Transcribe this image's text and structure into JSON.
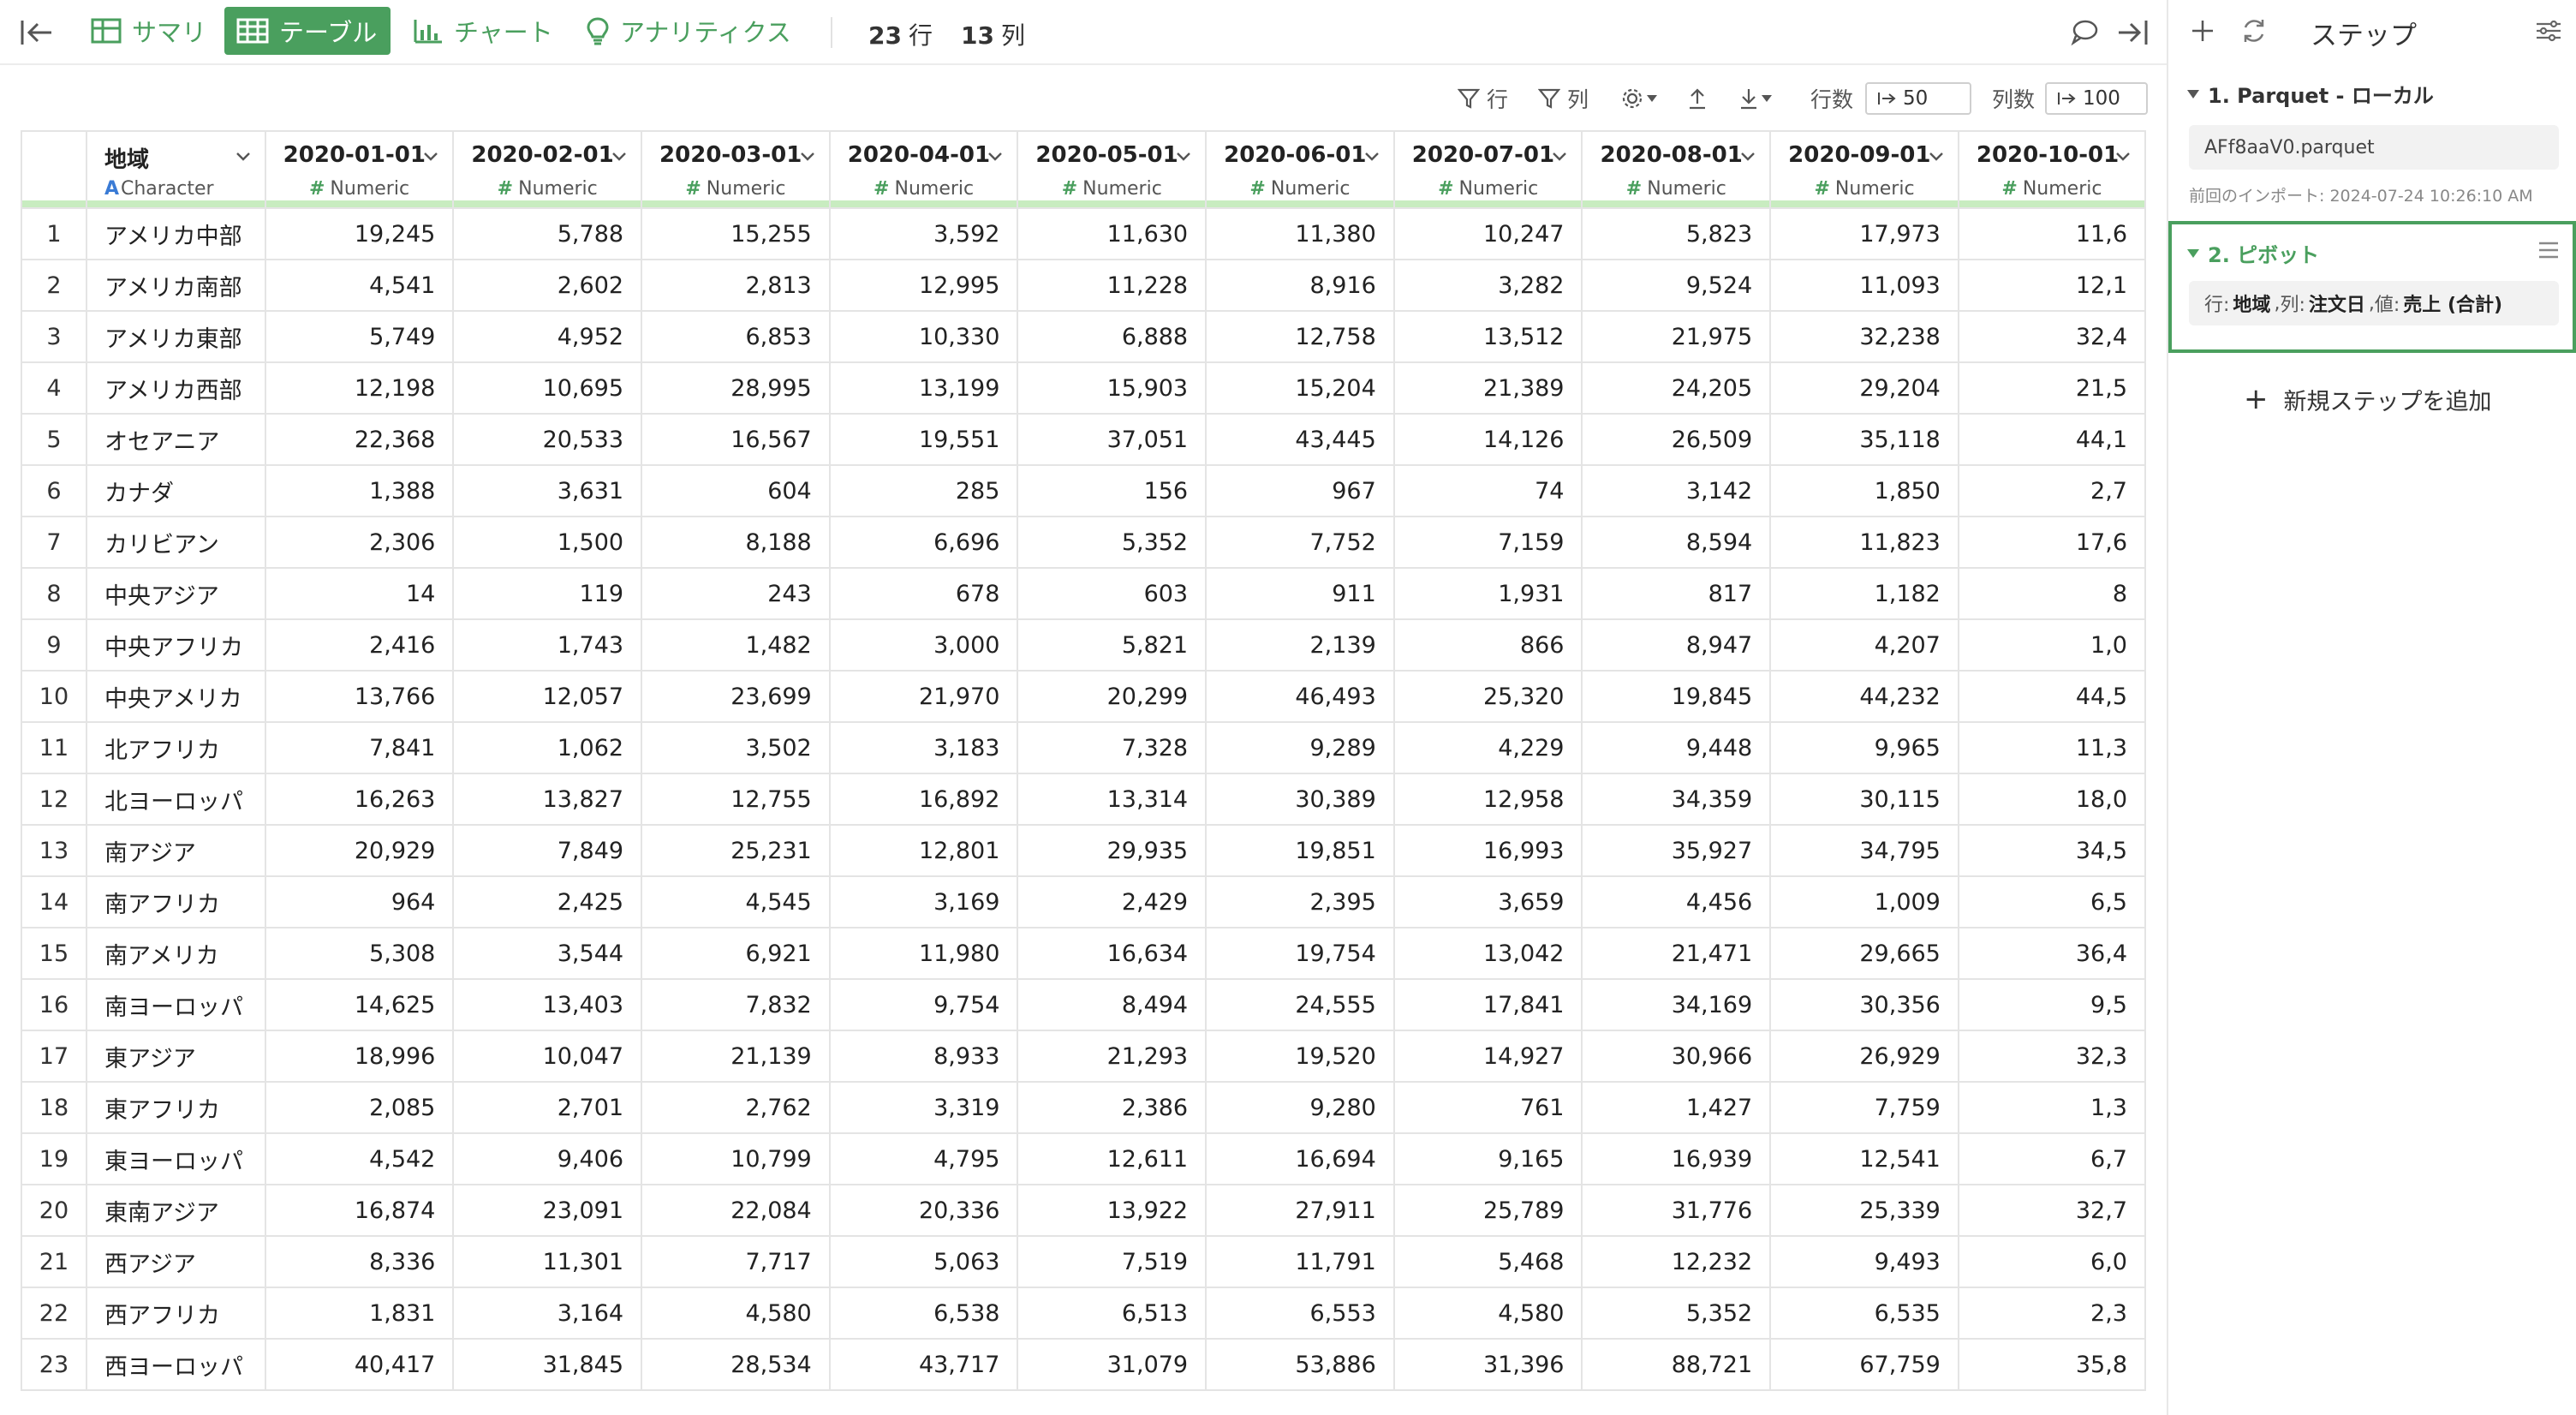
{
  "toolbar": {
    "tabs": [
      {
        "label": "サマリ",
        "active": false,
        "icon": "summary-grid-icon"
      },
      {
        "label": "テーブル",
        "active": true,
        "icon": "table-icon"
      },
      {
        "label": "チャート",
        "active": false,
        "icon": "chart-icon"
      },
      {
        "label": "アナリティクス",
        "active": false,
        "icon": "lightbulb-icon"
      }
    ],
    "row_count": "23",
    "row_count_unit": "行",
    "col_count": "13",
    "col_count_unit": "列"
  },
  "toolbar2": {
    "row_filter_label": "行",
    "col_filter_label": "列",
    "rows_label": "行数",
    "rows_value": "50",
    "cols_label": "列数",
    "cols_value": "100"
  },
  "table": {
    "columns": [
      {
        "name": "地域",
        "type": "Character"
      },
      {
        "name": "2020-01-01",
        "type": "Numeric"
      },
      {
        "name": "2020-02-01",
        "type": "Numeric"
      },
      {
        "name": "2020-03-01",
        "type": "Numeric"
      },
      {
        "name": "2020-04-01",
        "type": "Numeric"
      },
      {
        "name": "2020-05-01",
        "type": "Numeric"
      },
      {
        "name": "2020-06-01",
        "type": "Numeric"
      },
      {
        "name": "2020-07-01",
        "type": "Numeric"
      },
      {
        "name": "2020-08-01",
        "type": "Numeric"
      },
      {
        "name": "2020-09-01",
        "type": "Numeric"
      },
      {
        "name": "2020-10-01",
        "type": "Numeric"
      }
    ],
    "rows": [
      [
        "アメリカ中部",
        "19,245",
        "5,788",
        "15,255",
        "3,592",
        "11,630",
        "11,380",
        "10,247",
        "5,823",
        "17,973",
        "11,6"
      ],
      [
        "アメリカ南部",
        "4,541",
        "2,602",
        "2,813",
        "12,995",
        "11,228",
        "8,916",
        "3,282",
        "9,524",
        "11,093",
        "12,1"
      ],
      [
        "アメリカ東部",
        "5,749",
        "4,952",
        "6,853",
        "10,330",
        "6,888",
        "12,758",
        "13,512",
        "21,975",
        "32,238",
        "32,4"
      ],
      [
        "アメリカ西部",
        "12,198",
        "10,695",
        "28,995",
        "13,199",
        "15,903",
        "15,204",
        "21,389",
        "24,205",
        "29,204",
        "21,5"
      ],
      [
        "オセアニア",
        "22,368",
        "20,533",
        "16,567",
        "19,551",
        "37,051",
        "43,445",
        "14,126",
        "26,509",
        "35,118",
        "44,1"
      ],
      [
        "カナダ",
        "1,388",
        "3,631",
        "604",
        "285",
        "156",
        "967",
        "74",
        "3,142",
        "1,850",
        "2,7"
      ],
      [
        "カリビアン",
        "2,306",
        "1,500",
        "8,188",
        "6,696",
        "5,352",
        "7,752",
        "7,159",
        "8,594",
        "11,823",
        "17,6"
      ],
      [
        "中央アジア",
        "14",
        "119",
        "243",
        "678",
        "603",
        "911",
        "1,931",
        "817",
        "1,182",
        "8"
      ],
      [
        "中央アフリカ",
        "2,416",
        "1,743",
        "1,482",
        "3,000",
        "5,821",
        "2,139",
        "866",
        "8,947",
        "4,207",
        "1,0"
      ],
      [
        "中央アメリカ",
        "13,766",
        "12,057",
        "23,699",
        "21,970",
        "20,299",
        "46,493",
        "25,320",
        "19,845",
        "44,232",
        "44,5"
      ],
      [
        "北アフリカ",
        "7,841",
        "1,062",
        "3,502",
        "3,183",
        "7,328",
        "9,289",
        "4,229",
        "9,448",
        "9,965",
        "11,3"
      ],
      [
        "北ヨーロッパ",
        "16,263",
        "13,827",
        "12,755",
        "16,892",
        "13,314",
        "30,389",
        "12,958",
        "34,359",
        "30,115",
        "18,0"
      ],
      [
        "南アジア",
        "20,929",
        "7,849",
        "25,231",
        "12,801",
        "29,935",
        "19,851",
        "16,993",
        "35,927",
        "34,795",
        "34,5"
      ],
      [
        "南アフリカ",
        "964",
        "2,425",
        "4,545",
        "3,169",
        "2,429",
        "2,395",
        "3,659",
        "4,456",
        "1,009",
        "6,5"
      ],
      [
        "南アメリカ",
        "5,308",
        "3,544",
        "6,921",
        "11,980",
        "16,634",
        "19,754",
        "13,042",
        "21,471",
        "29,665",
        "36,4"
      ],
      [
        "南ヨーロッパ",
        "14,625",
        "13,403",
        "7,832",
        "9,754",
        "8,494",
        "24,555",
        "17,841",
        "34,169",
        "30,356",
        "9,5"
      ],
      [
        "東アジア",
        "18,996",
        "10,047",
        "21,139",
        "8,933",
        "21,293",
        "19,520",
        "14,927",
        "30,966",
        "26,929",
        "32,3"
      ],
      [
        "東アフリカ",
        "2,085",
        "2,701",
        "2,762",
        "3,319",
        "2,386",
        "9,280",
        "761",
        "1,427",
        "7,759",
        "1,3"
      ],
      [
        "東ヨーロッパ",
        "4,542",
        "9,406",
        "10,799",
        "4,795",
        "12,611",
        "16,694",
        "9,165",
        "16,939",
        "12,541",
        "6,7"
      ],
      [
        "東南アジア",
        "16,874",
        "23,091",
        "22,084",
        "20,336",
        "13,922",
        "27,911",
        "25,789",
        "31,776",
        "25,339",
        "32,7"
      ],
      [
        "西アジア",
        "8,336",
        "11,301",
        "7,717",
        "5,063",
        "7,519",
        "11,791",
        "5,468",
        "12,232",
        "9,493",
        "6,0"
      ],
      [
        "西アフリカ",
        "1,831",
        "3,164",
        "4,580",
        "6,538",
        "6,513",
        "6,553",
        "4,580",
        "5,352",
        "6,535",
        "2,3"
      ],
      [
        "西ヨーロッパ",
        "40,417",
        "31,845",
        "28,534",
        "43,717",
        "31,079",
        "53,886",
        "31,396",
        "88,721",
        "67,759",
        "35,8"
      ]
    ]
  },
  "steps_panel": {
    "title": "ステップ",
    "step1": {
      "title": "1. Parquet - ローカル",
      "file": "AFf8aaV0.parquet",
      "import_note": "前回のインポート: 2024-07-24 10:26:10 AM"
    },
    "step2": {
      "title": "2. ピボット",
      "rows_label": "行:",
      "rows_value": "地域",
      "cols_label": "列:",
      "cols_value": "注文日",
      "vals_label": "値:",
      "vals_value": "売上 (合計)"
    },
    "add_step_label": "新規ステップを追加"
  },
  "colors": {
    "accent": "#4a9f5e",
    "header_bar": "#c8ecc0",
    "character_type": "#3a7bd5"
  }
}
